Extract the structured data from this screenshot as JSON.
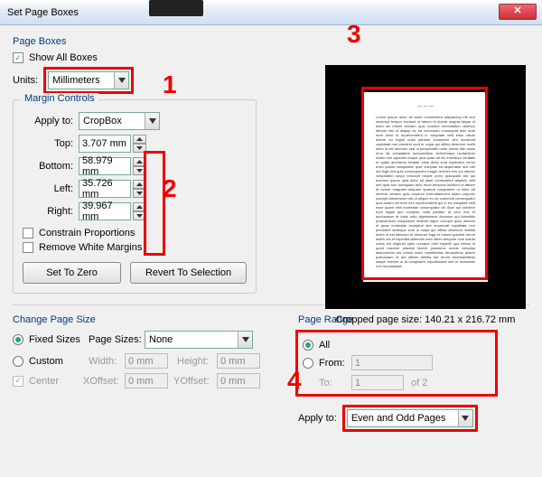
{
  "window": {
    "title": "Set Page Boxes"
  },
  "callouts": {
    "c1": "1",
    "c2": "2",
    "c3": "3",
    "c4": "4"
  },
  "pageBoxes": {
    "groupTitle": "Page Boxes",
    "showAllLabel": "Show All Boxes",
    "unitsLabel": "Units:",
    "unitsValue": "Millimeters"
  },
  "marginControls": {
    "legend": "Margin Controls",
    "applyToLabel": "Apply to:",
    "applyToValue": "CropBox",
    "fields": {
      "topLabel": "Top:",
      "topValue": "3.707 mm",
      "bottomLabel": "Bottom:",
      "bottomValue": "58.979 mm",
      "leftLabel": "Left:",
      "leftValue": "35.726 mm",
      "rightLabel": "Right:",
      "rightValue": "39.967 mm"
    },
    "constrainLabel": "Constrain Proportions",
    "removeWhiteLabel": "Remove White Margins",
    "setZero": "Set To Zero",
    "revert": "Revert To Selection"
  },
  "preview": {
    "caption": "Cropped page size: 140.21 x 216.72 mm"
  },
  "changePageSize": {
    "title": "Change Page Size",
    "fixedLabel": "Fixed Sizes",
    "customLabel": "Custom",
    "centerLabel": "Center",
    "pageSizesLabel": "Page Sizes:",
    "pageSizesValue": "None",
    "widthLabel": "Width:",
    "widthValue": "0 mm",
    "heightLabel": "Height:",
    "heightValue": "0 mm",
    "xoffLabel": "XOffset:",
    "xoffValue": "0 mm",
    "yoffLabel": "YOffset:",
    "yoffValue": "0 mm"
  },
  "pageRange": {
    "title": "Page Range",
    "allLabel": "All",
    "fromLabel": "From:",
    "fromValue": "1",
    "toLabel": "To:",
    "toValue": "1",
    "ofLabel": "of 2",
    "applyToLabel": "Apply to:",
    "applyToValue": "Even and Odd Pages"
  }
}
